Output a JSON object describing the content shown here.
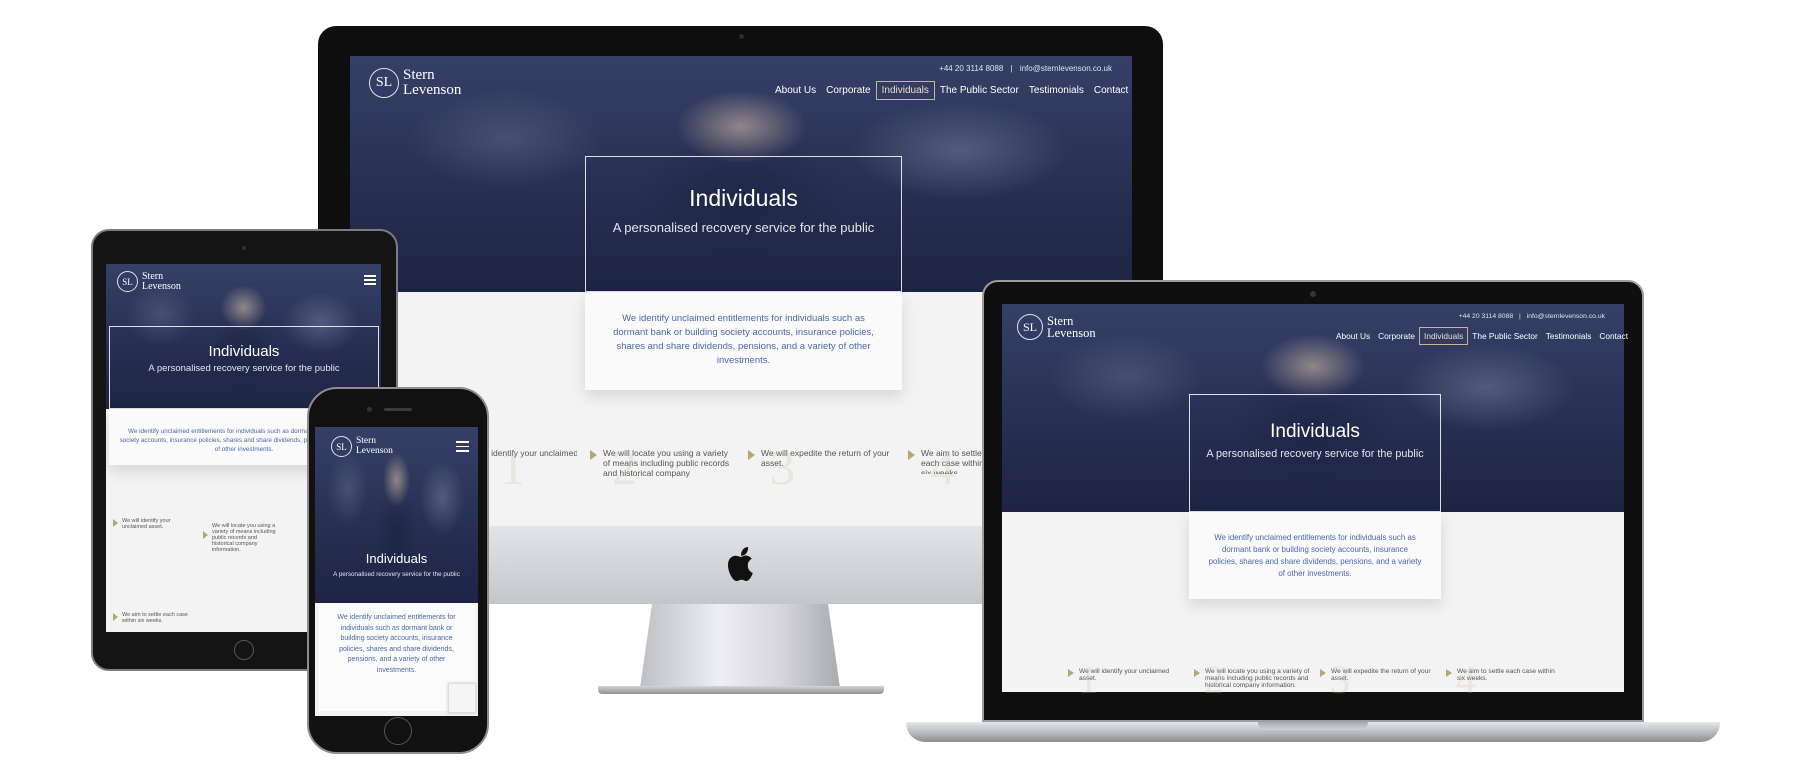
{
  "brand": {
    "monogram": "SL",
    "line1": "Stern",
    "line2": "Levenson"
  },
  "contact": {
    "phone": "+44 20 3114 8088",
    "separator": "|",
    "email": "info@sternlevenson.co.uk"
  },
  "nav": {
    "items": [
      "About Us",
      "Corporate",
      "Individuals",
      "The Public Sector",
      "Testimonials",
      "Contact"
    ],
    "active": "Individuals"
  },
  "hero": {
    "title": "Individuals",
    "subtitle": "A personalised recovery service for the public"
  },
  "intro": "We identify unclaimed entitlements for individuals such as dormant bank or building society accounts, insurance policies, shares and share dividends, pensions, and a variety of other investments.",
  "steps": [
    {
      "num": "1",
      "text": "We will identify your unclaimed asset."
    },
    {
      "num": "2",
      "text": "We will locate you using a variety of means including public records and historical company information."
    },
    {
      "num": "3",
      "text": "We will expedite the return of your asset."
    },
    {
      "num": "4",
      "text": "We aim to settle each case within six weeks."
    }
  ],
  "colors": {
    "hero_navy": "#2a3257",
    "accent_gold": "#b9a56f",
    "intro_blue": "#4b67a8",
    "device_black": "#121212"
  }
}
